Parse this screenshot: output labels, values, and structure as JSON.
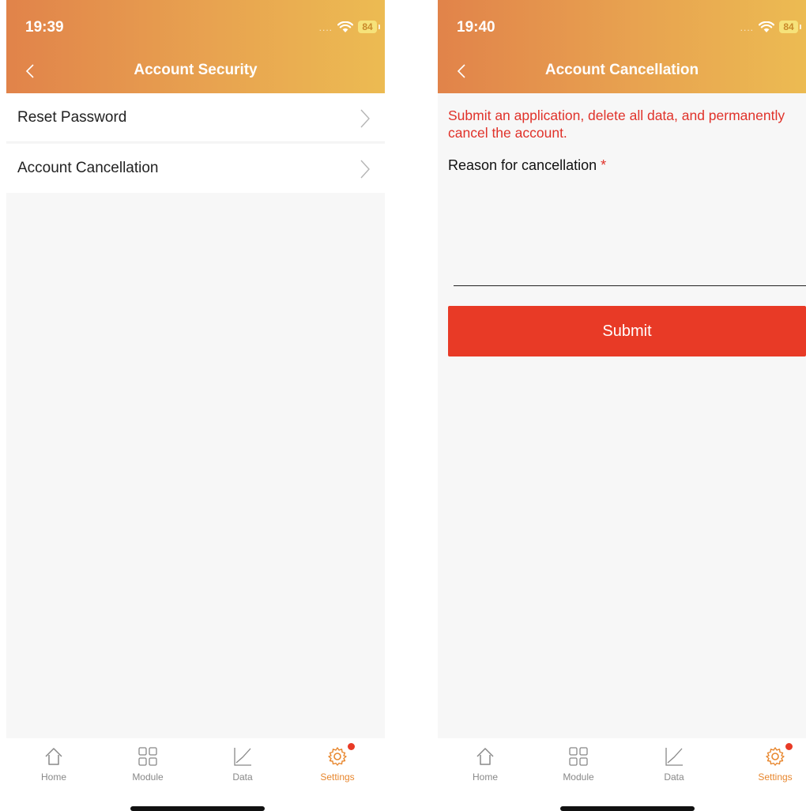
{
  "left_screen": {
    "status": {
      "time": "19:39",
      "battery": "84"
    },
    "nav": {
      "title": "Account Security"
    },
    "menu": [
      {
        "label": "Reset Password"
      },
      {
        "label": "Account Cancellation"
      }
    ]
  },
  "right_screen": {
    "status": {
      "time": "19:40",
      "battery": "84"
    },
    "nav": {
      "title": "Account Cancellation"
    },
    "warning": "Submit an application, delete all data, and permanently cancel the account.",
    "reason_label": "Reason for cancellation",
    "required_mark": "*",
    "reason_value": "",
    "submit_label": "Submit"
  },
  "tabbar": {
    "items": [
      {
        "label": "Home",
        "icon": "home-icon"
      },
      {
        "label": "Module",
        "icon": "grid-icon"
      },
      {
        "label": "Data",
        "icon": "chart-icon"
      },
      {
        "label": "Settings",
        "icon": "gear-icon",
        "active": true,
        "badge": true
      }
    ]
  },
  "colors": {
    "header_gradient_start": "#e1834a",
    "header_gradient_end": "#ecbb52",
    "warning_text": "#e0322a",
    "submit_button": "#e83a26",
    "active_tab": "#e8872e",
    "badge": "#e83a26"
  }
}
